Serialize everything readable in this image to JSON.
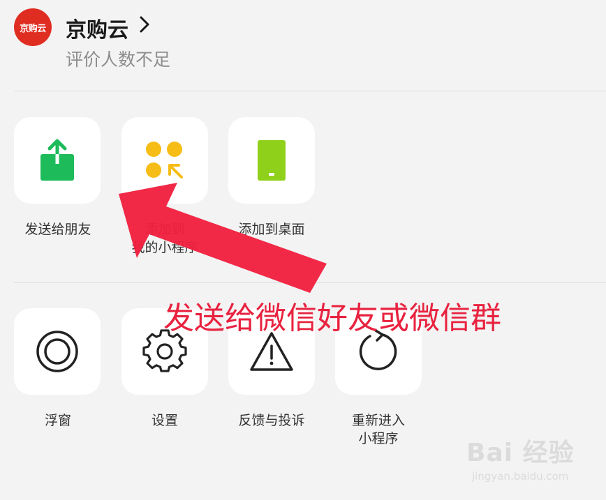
{
  "header": {
    "logo_text": "京购云",
    "app_name": "京购云",
    "rating_text": "评价人数不足"
  },
  "row1": {
    "items": [
      {
        "label": "发送给朋友",
        "icon": "share-icon",
        "color": "#1dbb5a"
      },
      {
        "label_line1": "添加到",
        "label_line2": "我的小程序",
        "icon": "mini-program-icon",
        "color": "#f6bd16"
      },
      {
        "label": "添加到桌面",
        "icon": "phone-icon",
        "color": "#8fd11a"
      }
    ]
  },
  "row2": {
    "items": [
      {
        "label": "浮窗",
        "icon": "float-window-icon"
      },
      {
        "label": "设置",
        "icon": "gear-icon"
      },
      {
        "label": "反馈与投诉",
        "icon": "warning-icon"
      },
      {
        "label_line1": "重新进入",
        "label_line2": "小程序",
        "icon": "refresh-icon"
      }
    ]
  },
  "annotation": {
    "text": "发送给微信好友或微信群",
    "color": "#e8223f"
  },
  "watermark": {
    "main": "Bai 经验",
    "sub": "jingyan.baidu.com"
  }
}
